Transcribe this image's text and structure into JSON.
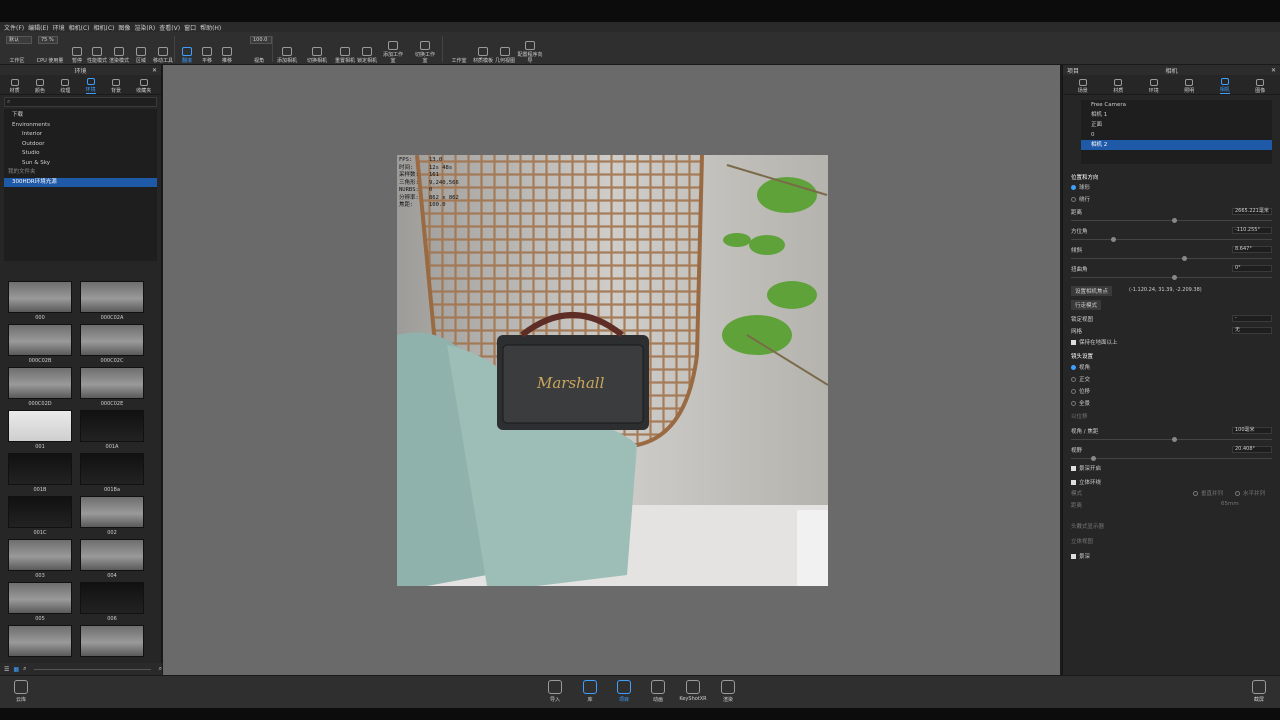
{
  "menu": [
    "文件(F)",
    "编辑(E)",
    "环境",
    "相机(C)",
    "相机(C)",
    "图像",
    "渲染(R)",
    "查看(V)",
    "窗口",
    "帮助(H)"
  ],
  "toolbar": {
    "preset_value": "默认",
    "slider_value": "75 %",
    "zoom_value": "100.0",
    "buttons": [
      "工作区",
      "CPU 使用量",
      "暂停",
      "性能模式",
      "渲染模式",
      "区域",
      "移动工具",
      "翻滚",
      "平移",
      "推移",
      "视角",
      "添加相机",
      "切换相机",
      "重置相机",
      "锁定相机",
      "添加工作室",
      "切换工作室",
      "工作室",
      "材质模板",
      "几何视图",
      "配置程序向导"
    ]
  },
  "left_panel": {
    "header": "环境",
    "tabs": [
      "材质",
      "颜色",
      "纹理",
      "环境",
      "背景",
      "收藏夹"
    ],
    "active_tab": "环境",
    "search_placeholder": "",
    "tree": [
      "下载",
      "Environments",
      "Interior",
      "Outdoor",
      "Studio",
      "Sun & Sky",
      "我的文件夹",
      "300HDR环境光源"
    ],
    "thumbs": [
      "000",
      "000C02A",
      "000C02B",
      "000C02C",
      "000C02D",
      "000C02E",
      "001",
      "001A",
      "001B",
      "001Ba",
      "001C",
      "002",
      "003",
      "004",
      "005",
      "006"
    ]
  },
  "render_stats": [
    {
      "k": "FPS:",
      "v": "13.0"
    },
    {
      "k": "时间:",
      "v": "12s 48s"
    },
    {
      "k": "采样数:",
      "v": "161"
    },
    {
      "k": "三角形:",
      "v": "9,240,566"
    },
    {
      "k": "NURBS:",
      "v": "0"
    },
    {
      "k": "分辨率:",
      "v": "862 x 862"
    },
    {
      "k": "焦距:",
      "v": "100.0"
    }
  ],
  "right_panel": {
    "title_left": "项目",
    "title_center": "相机",
    "tabs": [
      "场景",
      "材质",
      "环境",
      "照明",
      "相机",
      "图像"
    ],
    "active_tab": "相机",
    "cameras": [
      "Free Camera",
      "相机 1",
      "正面",
      "0",
      "相机 2"
    ],
    "section_position": "位置和方向",
    "radio_a": "球形",
    "radio_b": "绕行",
    "distance_label": "距离",
    "distance_value": "2665.221毫米",
    "azimuth_label": "方位角",
    "azimuth_value": "-110.255°",
    "incline_label": "倾斜",
    "incline_value": "8.647°",
    "twist_label": "扭曲角",
    "twist_value": "0°",
    "set_lookat": "设置相机焦点",
    "lookat_coords": "(-1.120.24, 31.39, -2.209.38)",
    "walk_mode": "行走模式",
    "lock_view_label": "锁定视图",
    "lock_view_value": "-",
    "grid_label": "网格",
    "grid_value": "无",
    "keep_above": "保持在地面以上",
    "lens_section": "镜头设置",
    "lens_options": [
      "视角",
      "正交",
      "位移",
      "全景"
    ],
    "shift_label": "以位移",
    "fov_label": "视角 / 焦距",
    "fov_value": "100毫米",
    "field_label": "视野",
    "field_value": "20.408°",
    "depth_label": "景深开启",
    "stereo_label": "立体环绕",
    "mode_label": "模式",
    "spacing_label": "距离",
    "mode_opt1": "垂直并列",
    "mode_opt2": "水平并列",
    "spacing_value": "65mm",
    "headset_label": "头戴式显示器",
    "stereo_view": "立体视图",
    "dof_label": "景深"
  },
  "dock": {
    "buttons": [
      "导入",
      "库",
      "项目",
      "动画",
      "KeyShotXR",
      "渲染"
    ],
    "active": "项目",
    "left_label": "云库",
    "right_label": "截屏"
  }
}
